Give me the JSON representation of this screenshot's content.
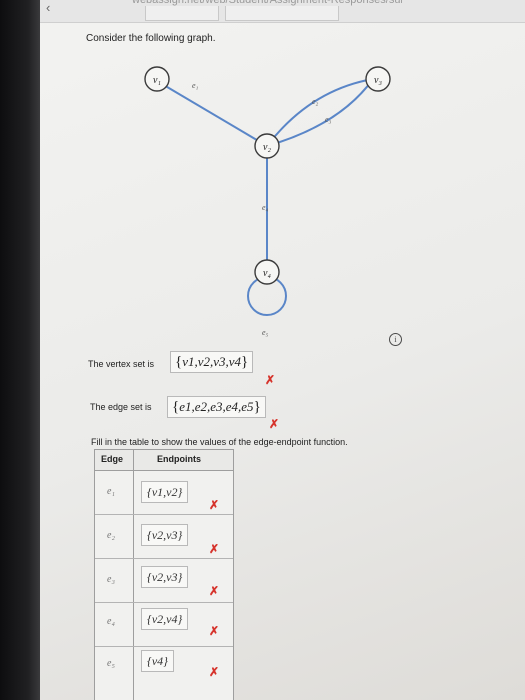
{
  "browser": {
    "url": "webassign.net/web/Student/Assignment-Responses/submit?dep=..."
  },
  "question": {
    "prompt": "Consider the following graph."
  },
  "graph": {
    "vertices": [
      {
        "id": "v1",
        "label": "v₁"
      },
      {
        "id": "v2",
        "label": "v₂"
      },
      {
        "id": "v3",
        "label": "v₃"
      },
      {
        "id": "v4",
        "label": "v₄"
      }
    ],
    "edges": [
      {
        "id": "e1",
        "label": "e₁"
      },
      {
        "id": "e2",
        "label": "e₂"
      },
      {
        "id": "e3",
        "label": "e₃"
      },
      {
        "id": "e4",
        "label": "e₄"
      },
      {
        "id": "e5",
        "label": "e₅"
      }
    ]
  },
  "vertex_set": {
    "label": "The vertex set is",
    "answer": "v1,v2,v3,v4",
    "status": "incorrect"
  },
  "edge_set": {
    "label": "The edge set is",
    "answer": "e1,e2,e3,e4,e5",
    "status": "incorrect"
  },
  "table": {
    "instruction": "Fill in the table to show the values of the edge-endpoint function.",
    "headers": {
      "edge": "Edge",
      "endpoints": "Endpoints"
    },
    "rows": [
      {
        "edge": "e₁",
        "endpoints": "v1,v2",
        "status": "incorrect"
      },
      {
        "edge": "e₂",
        "endpoints": "v2,v3",
        "status": "incorrect"
      },
      {
        "edge": "e₃",
        "endpoints": "v2,v3",
        "status": "incorrect"
      },
      {
        "edge": "e₄",
        "endpoints": "v2,v4",
        "status": "incorrect"
      },
      {
        "edge": "e₅",
        "endpoints": "v4",
        "status": "incorrect"
      }
    ]
  },
  "icons": {
    "info": "info-icon",
    "incorrect": "x-mark-icon"
  },
  "colors": {
    "edge_line": "#5a86c8",
    "incorrect_mark": "#d6342c"
  }
}
